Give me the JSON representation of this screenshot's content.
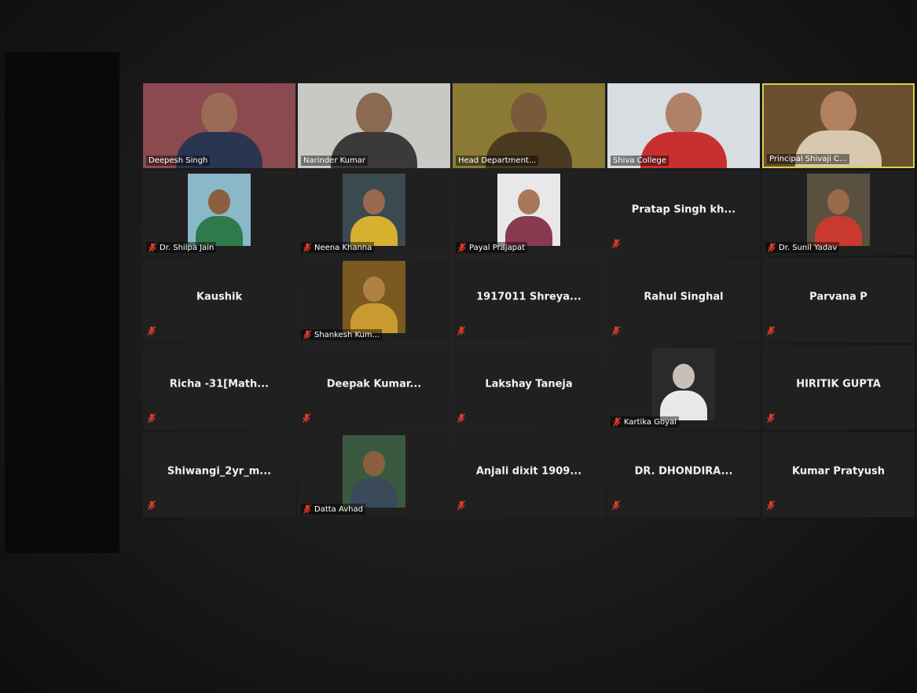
{
  "colors": {
    "active_speaker_border": "#d8d048",
    "muted_icon": "#e03a2a",
    "tile_background": "#202020"
  },
  "participants": [
    {
      "name": "Deepesh Singh",
      "video": true,
      "muted": false,
      "bg": "#8a4a50",
      "skin": "#9b6b55",
      "shirt": "#2a3550"
    },
    {
      "name": "Narinder Kumar",
      "video": true,
      "muted": false,
      "bg": "#c8c8c4",
      "skin": "#8a6a50",
      "shirt": "#3a3a3a"
    },
    {
      "name": "Head Department...",
      "video": true,
      "muted": false,
      "bg": "#8a7a35",
      "skin": "#7a5a3a",
      "shirt": "#4a3a20"
    },
    {
      "name": "Shiva College",
      "video": true,
      "muted": false,
      "bg": "#d8dde2",
      "skin": "#b08068",
      "shirt": "#c83030"
    },
    {
      "name": "Principal Shivaji C...",
      "video": true,
      "muted": false,
      "active": true,
      "bg": "#6a5030",
      "skin": "#b08060",
      "shirt": "#d8c8b0"
    },
    {
      "name": "Dr. Shilpa Jain",
      "video": true,
      "muted": true,
      "thumb": true,
      "bg": "#8ab8c8",
      "skin": "#8a6040",
      "shirt": "#2f7a4a"
    },
    {
      "name": "Neena Khanna",
      "video": true,
      "muted": true,
      "thumb": true,
      "bg": "#3a4a50",
      "skin": "#9a6a50",
      "shirt": "#d8b030"
    },
    {
      "name": "Payal Prajapat",
      "video": true,
      "muted": true,
      "thumb": true,
      "bg": "#e8e8e8",
      "skin": "#a87858",
      "shirt": "#8a3a50"
    },
    {
      "name": "Pratap Singh kh...",
      "video": false,
      "muted": true
    },
    {
      "name": "Dr. Sunil Yadav",
      "video": true,
      "muted": true,
      "thumb": true,
      "bg": "#5a5040",
      "skin": "#9a6a4a",
      "shirt": "#c83a30"
    },
    {
      "name": "Kaushik",
      "video": false,
      "muted": true
    },
    {
      "name": "Shankesh Kum...",
      "video": true,
      "muted": true,
      "thumb": true,
      "bg": "#7a5a20",
      "skin": "#b08040",
      "shirt": "#c89a30"
    },
    {
      "name": "1917011 Shreya...",
      "video": false,
      "muted": true
    },
    {
      "name": "Rahul Singhal",
      "video": false,
      "muted": true
    },
    {
      "name": "Parvana P",
      "video": false,
      "muted": true
    },
    {
      "name": "Richa -31[Math...",
      "video": false,
      "muted": true
    },
    {
      "name": "Deepak Kumar...",
      "video": false,
      "muted": true
    },
    {
      "name": "Lakshay Taneja",
      "video": false,
      "muted": true
    },
    {
      "name": "Kartika Goyal",
      "video": true,
      "muted": true,
      "thumb": true,
      "bg": "#2a2a2a",
      "skin": "#c8c0b8",
      "shirt": "#e8e8e8"
    },
    {
      "name": "HIRITIK GUPTA",
      "video": false,
      "muted": true
    },
    {
      "name": "Shiwangi_2yr_m...",
      "video": false,
      "muted": true
    },
    {
      "name": "Datta Avhad",
      "video": true,
      "muted": true,
      "thumb": true,
      "bg": "#3a5a40",
      "skin": "#8a6040",
      "shirt": "#3a4a5a"
    },
    {
      "name": "Anjali dixit 1909...",
      "video": false,
      "muted": true
    },
    {
      "name": "DR. DHONDIRA...",
      "video": false,
      "muted": true
    },
    {
      "name": "Kumar Pratyush",
      "video": false,
      "muted": true
    }
  ]
}
